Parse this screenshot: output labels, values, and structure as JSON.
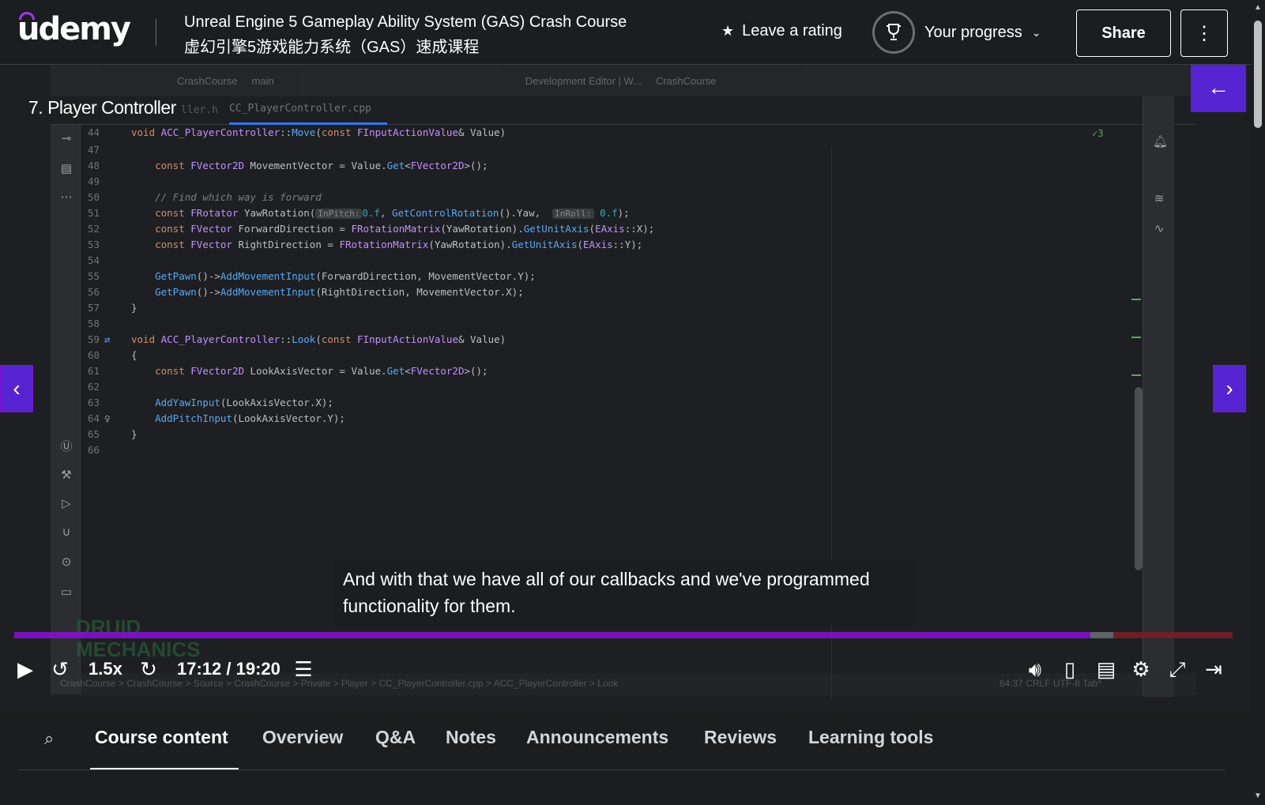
{
  "header": {
    "logo_text": "udemy",
    "course_title_en": "Unreal Engine 5 Gameplay Ability System (GAS) Crash Course",
    "course_title_zh": "虚幻引擎5游戏能力系统（GAS）速成课程",
    "rating_label": "Leave a rating",
    "progress_label": "Your progress",
    "share_label": "Share"
  },
  "player": {
    "lecture_title": "7. Player Controller",
    "subtitle": "And with that we have all of our callbacks and we've programmed functionality for them.",
    "speed": "1.5x",
    "time": "17:12 / 19:20",
    "progress_fraction": 0.883,
    "buffer_fraction": 0.902
  },
  "ide": {
    "branch": "CrashCourse",
    "git_branch": "main",
    "config": "Development Editor | W...",
    "run_target": "CrashCourse",
    "active_tab": "CC_PlayerController.cpp",
    "ghost_tab": "ller.h",
    "status_path": "CrashCourse  >  CrashCourse  >  Source  >  CrashCourse  >  Private  >  Player  >  CC_PlayerController.cpp  >  ACC_PlayerController  >  Look",
    "status_right": "64:37   CRLF   UTF-8   Tab*",
    "inspection_count": "✓3",
    "watermark": "DRUID MECHANICS"
  },
  "tabs": {
    "course_content": "Course content",
    "overview": "Overview",
    "qa": "Q&A",
    "notes": "Notes",
    "announcements": "Announcements",
    "reviews": "Reviews",
    "learning_tools": "Learning tools"
  },
  "colors": {
    "accent": "#5624d0",
    "progress": "#8710d8",
    "header_bg": "#1c1d1f"
  }
}
